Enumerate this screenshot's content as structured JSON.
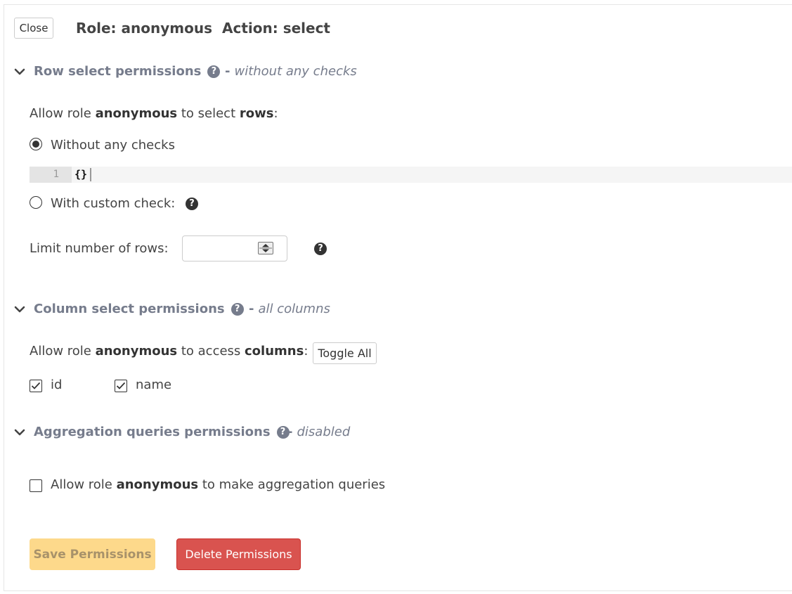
{
  "header": {
    "close_label": "Close",
    "role_title": "Role: anonymous",
    "action_title": "Action: select"
  },
  "row_section": {
    "title": "Row select permissions",
    "note": "without any checks",
    "allow_prefix": "Allow role ",
    "role": "anonymous",
    "allow_middle": " to select ",
    "target": "rows",
    "allow_suffix": ":",
    "option_without": "Without any checks",
    "option_custom": "With custom check:",
    "editor_line_number": "1",
    "editor_code": "{}",
    "limit_label": "Limit number of rows:",
    "limit_value": ""
  },
  "column_section": {
    "title": "Column select permissions",
    "note": "all columns",
    "allow_prefix": "Allow role ",
    "role": "anonymous",
    "allow_middle": " to access ",
    "target": "columns",
    "allow_suffix": ":",
    "toggle_all_label": "Toggle All",
    "columns": [
      {
        "name": "id",
        "checked": true
      },
      {
        "name": "name",
        "checked": true
      }
    ]
  },
  "aggregation_section": {
    "title": "Aggregation queries permissions",
    "note": "disabled",
    "allow_prefix": "Allow role ",
    "role": "anonymous",
    "allow_suffix": " to make aggregation queries",
    "checked": false
  },
  "footer": {
    "save_label": "Save Permissions",
    "delete_label": "Delete Permissions"
  },
  "icons": {
    "help": "question-circle-icon",
    "section_toggle": "chevron-down-icon",
    "checkmark": "check-icon",
    "spinner": "number-spinner-icon"
  },
  "dash": "-",
  "colors": {
    "section_heading": "#767c8c",
    "save_bg": "#fdd98b",
    "delete_bg": "#d9534f"
  }
}
